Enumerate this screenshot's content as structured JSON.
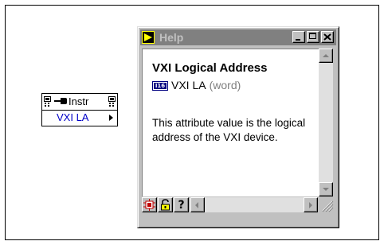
{
  "node": {
    "header_label": "Instr",
    "property_label": "VXI LA"
  },
  "help_window": {
    "title": "Help",
    "heading": "VXI Logical Address",
    "type_icon_text": "I16",
    "property_name": "VXI LA",
    "data_type": "(word)",
    "description": "This attribute value is the logical address of the VXI device.",
    "help_button_label": "?"
  },
  "colors": {
    "titlebar_inactive": "#808080",
    "property_text": "#0000c8",
    "datatype_text": "#7f7f7f"
  }
}
